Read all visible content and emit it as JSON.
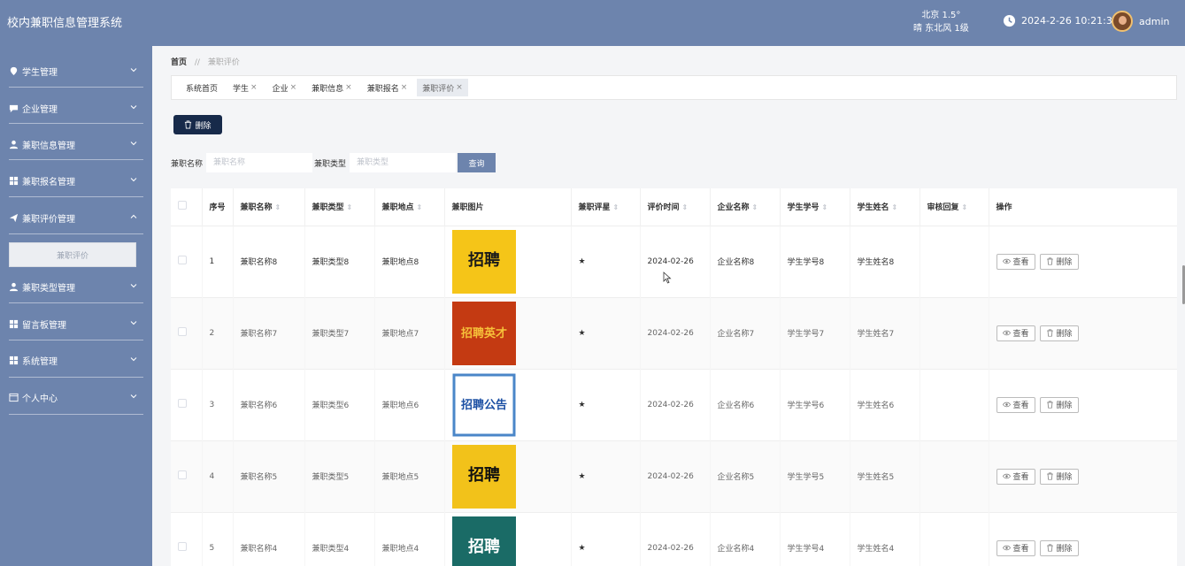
{
  "app": {
    "title": "校内兼职信息管理系统"
  },
  "header": {
    "weather_city": "北京  1.5°",
    "weather_desc": "晴  东北风  1级",
    "datetime": "2024-2-26 10:21:32",
    "username": "admin"
  },
  "sidebar": {
    "items": [
      {
        "label": "学生管理",
        "icon": "location-icon"
      },
      {
        "label": "企业管理",
        "icon": "chat-icon"
      },
      {
        "label": "兼职信息管理",
        "icon": "user-icon"
      },
      {
        "label": "兼职报名管理",
        "icon": "grid-icon"
      },
      {
        "label": "兼职评价管理",
        "icon": "send-icon"
      },
      {
        "label": "兼职类型管理",
        "icon": "user-icon"
      },
      {
        "label": "留言板管理",
        "icon": "grid-icon"
      },
      {
        "label": "系统管理",
        "icon": "grid-icon"
      },
      {
        "label": "个人中心",
        "icon": "window-icon"
      }
    ],
    "submenu_label": "兼职评价"
  },
  "breadcrumb": {
    "home": "首页",
    "separator": "//",
    "current": "兼职评价"
  },
  "tabs": [
    {
      "label": "系统首页",
      "closable": false
    },
    {
      "label": "学生",
      "closable": true
    },
    {
      "label": "企业",
      "closable": true
    },
    {
      "label": "兼职信息",
      "closable": true
    },
    {
      "label": "兼职报名",
      "closable": true
    },
    {
      "label": "兼职评价",
      "closable": true
    }
  ],
  "tab_close_glyph": "×",
  "toolbar": {
    "delete_label": "删除"
  },
  "search": {
    "name_label": "兼职名称",
    "name_placeholder": "兼职名称",
    "type_label": "兼职类型",
    "type_placeholder": "兼职类型",
    "query_label": "查询"
  },
  "table": {
    "columns": [
      "序号",
      "兼职名称",
      "兼职类型",
      "兼职地点",
      "兼职图片",
      "兼职评星",
      "评价时间",
      "企业名称",
      "学生学号",
      "学生姓名",
      "审核回复",
      "操作"
    ],
    "sort_glyph": "⇕",
    "rows": [
      {
        "index": "1",
        "name": "兼职名称8",
        "type": "兼职类型8",
        "location": "兼职地点8",
        "rating": "★",
        "time": "2024-02-26",
        "company": "企业名称8",
        "student_id": "学生学号8",
        "student_name": "学生姓名8",
        "reply": ""
      },
      {
        "index": "2",
        "name": "兼职名称7",
        "type": "兼职类型7",
        "location": "兼职地点7",
        "rating": "★",
        "time": "2024-02-26",
        "company": "企业名称7",
        "student_id": "学生学号7",
        "student_name": "学生姓名7",
        "reply": ""
      },
      {
        "index": "3",
        "name": "兼职名称6",
        "type": "兼职类型6",
        "location": "兼职地点6",
        "rating": "★",
        "time": "2024-02-26",
        "company": "企业名称6",
        "student_id": "学生学号6",
        "student_name": "学生姓名6",
        "reply": ""
      },
      {
        "index": "4",
        "name": "兼职名称5",
        "type": "兼职类型5",
        "location": "兼职地点5",
        "rating": "★",
        "time": "2024-02-26",
        "company": "企业名称5",
        "student_id": "学生学号5",
        "student_name": "学生姓名5",
        "reply": ""
      },
      {
        "index": "5",
        "name": "兼职名称4",
        "type": "兼职类型4",
        "location": "兼职地点4",
        "rating": "★",
        "time": "2024-02-26",
        "company": "企业名称4",
        "student_id": "学生学号4",
        "student_name": "学生姓名4",
        "reply": ""
      }
    ],
    "row_actions": {
      "view_label": "查看",
      "delete_label": "删除"
    }
  },
  "thumbnails": [
    {
      "text": "招聘",
      "fg": "#1a1a1a",
      "bg": "#f5c518"
    },
    {
      "text": "招聘英才",
      "fg": "#f6c13a",
      "bg": "#c43a12"
    },
    {
      "text": "招聘公告",
      "fg": "#1b4fa3",
      "bg": "#ffffff"
    },
    {
      "text": "招聘",
      "fg": "#111111",
      "bg": "#f2c21a"
    },
    {
      "text": "招聘",
      "fg": "#ffffff",
      "bg": "#1a6b66"
    }
  ],
  "colors": {
    "primary": "#6d84ad",
    "dark_button": "#172a4a"
  }
}
